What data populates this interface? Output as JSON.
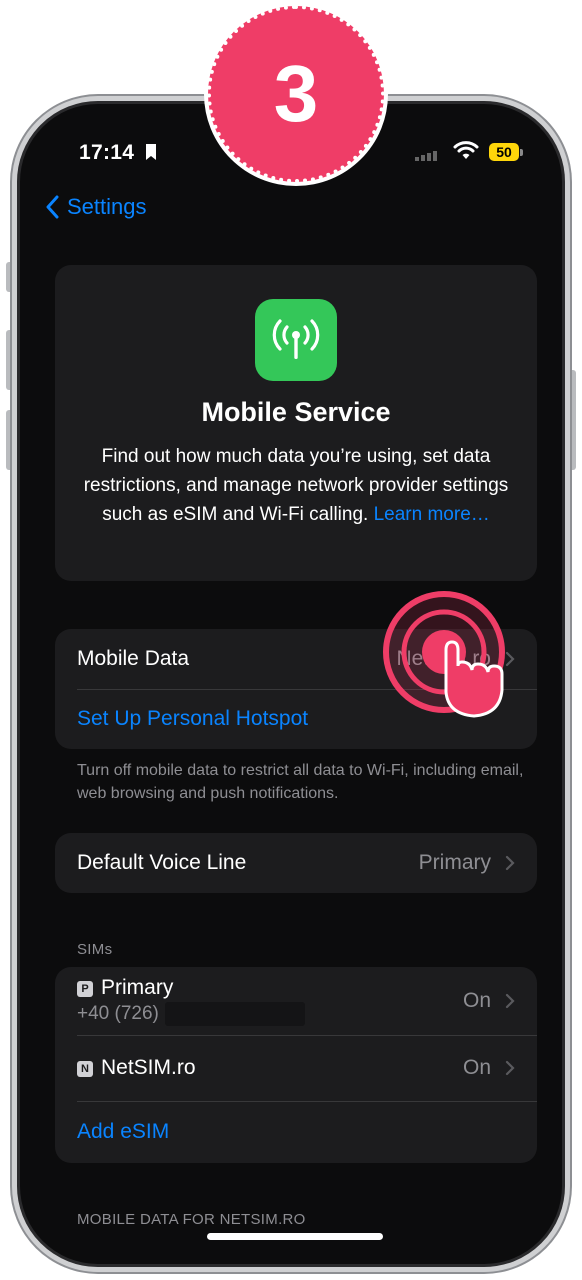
{
  "tutorial": {
    "step_number": "3"
  },
  "status_bar": {
    "time": "17:14",
    "battery": "50"
  },
  "nav": {
    "back_label": "Settings"
  },
  "hero": {
    "icon": "antenna-icon",
    "title": "Mobile Service",
    "description": "Find out how much data you’re using, set data restrictions, and manage network provider settings such as eSIM and Wi-Fi calling.",
    "link": "Learn more…"
  },
  "mobile_data_group": {
    "mobile_data_label": "Mobile Data",
    "mobile_data_value": "NetSIM.ro",
    "hotspot_label": "Set Up Personal Hotspot",
    "footer": "Turn off mobile data to restrict all data to Wi-Fi, including email, web browsing and push notifications."
  },
  "voice_group": {
    "label": "Default Voice Line",
    "value": "Primary"
  },
  "sims": {
    "header": "SIMs",
    "items": [
      {
        "badge": "P",
        "name": "Primary",
        "number": "+40 (726)",
        "status": "On"
      },
      {
        "badge": "N",
        "name": "NetSIM.ro",
        "status": "On"
      }
    ],
    "add_esim": "Add eSIM"
  },
  "next_section_header": "MOBILE DATA FOR NETSIM.RO",
  "colors": {
    "accent": "#0a84ff",
    "icon_green": "#34c759",
    "highlight": "#ef3d67",
    "battery": "#ffd60a"
  }
}
